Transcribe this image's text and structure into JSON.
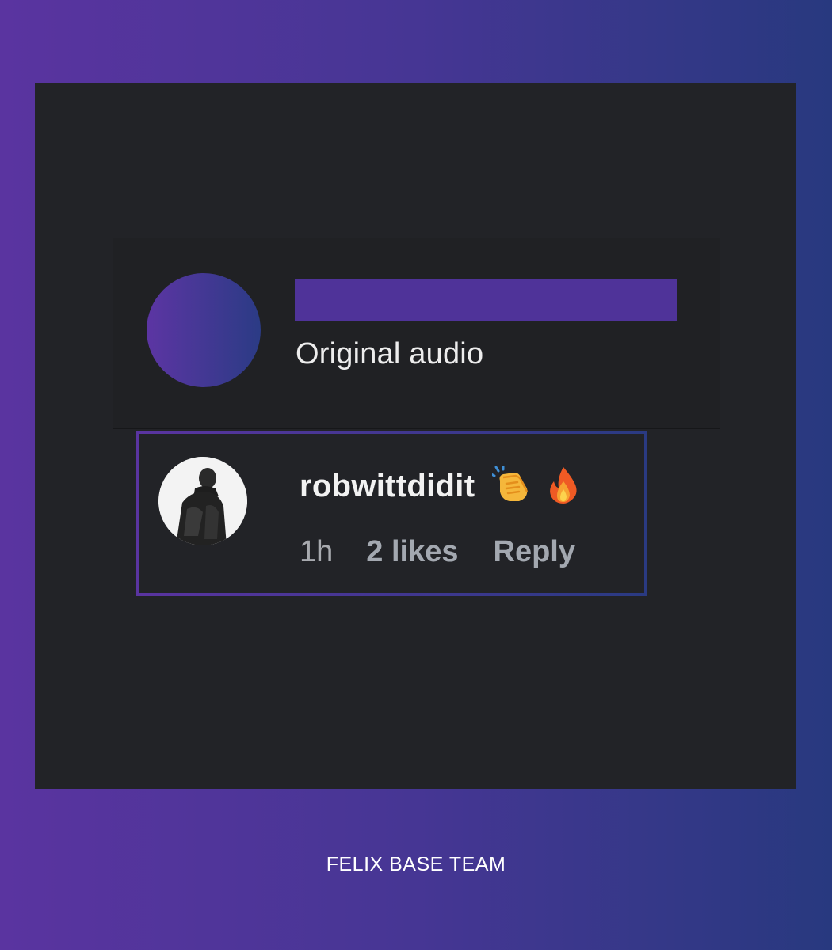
{
  "post": {
    "subtitle": "Original audio"
  },
  "comment": {
    "username": "robwittdidit",
    "emojis": [
      "clapping-hands-icon",
      "fire-icon"
    ],
    "time": "1h",
    "likes": "2 likes",
    "reply_label": "Reply"
  },
  "footer": {
    "text": "FELIX BASE TEAM"
  },
  "colors": {
    "background_gradient_start": "#5a34a0",
    "background_gradient_end": "#28397f",
    "panel": "#222327",
    "redaction": "#4f3399"
  }
}
